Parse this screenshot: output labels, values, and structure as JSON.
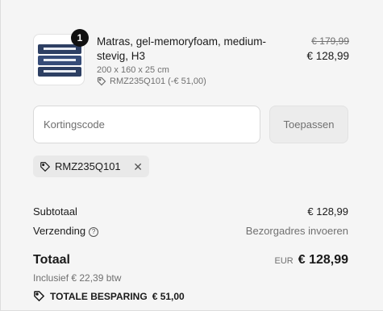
{
  "product": {
    "title": "Matras, gel-memoryfoam, medium-stevig, H3",
    "quantity": "1",
    "variant": "200 x 160 x 25 cm",
    "discount_tag": "RMZ235Q101 (-€ 51,00)",
    "old_price": "€ 179,99",
    "new_price": "€ 128,99"
  },
  "discount": {
    "placeholder": "Kortingscode",
    "apply_label": "Toepassen",
    "applied_code": "RMZ235Q101"
  },
  "summary": {
    "subtotal_label": "Subtotaal",
    "subtotal_value": "€ 128,99",
    "shipping_label": "Verzending",
    "shipping_value": "Bezorgadres invoeren",
    "total_label": "Totaal",
    "currency": "EUR",
    "total_value": "€ 128,99",
    "tax_note": "Inclusief € 22,39 btw",
    "savings_label": "TOTALE BESPARING",
    "savings_value": "€ 51,00"
  },
  "icons": {
    "tag": "tag-icon",
    "help": "help-circle-icon",
    "close": "close-icon"
  }
}
